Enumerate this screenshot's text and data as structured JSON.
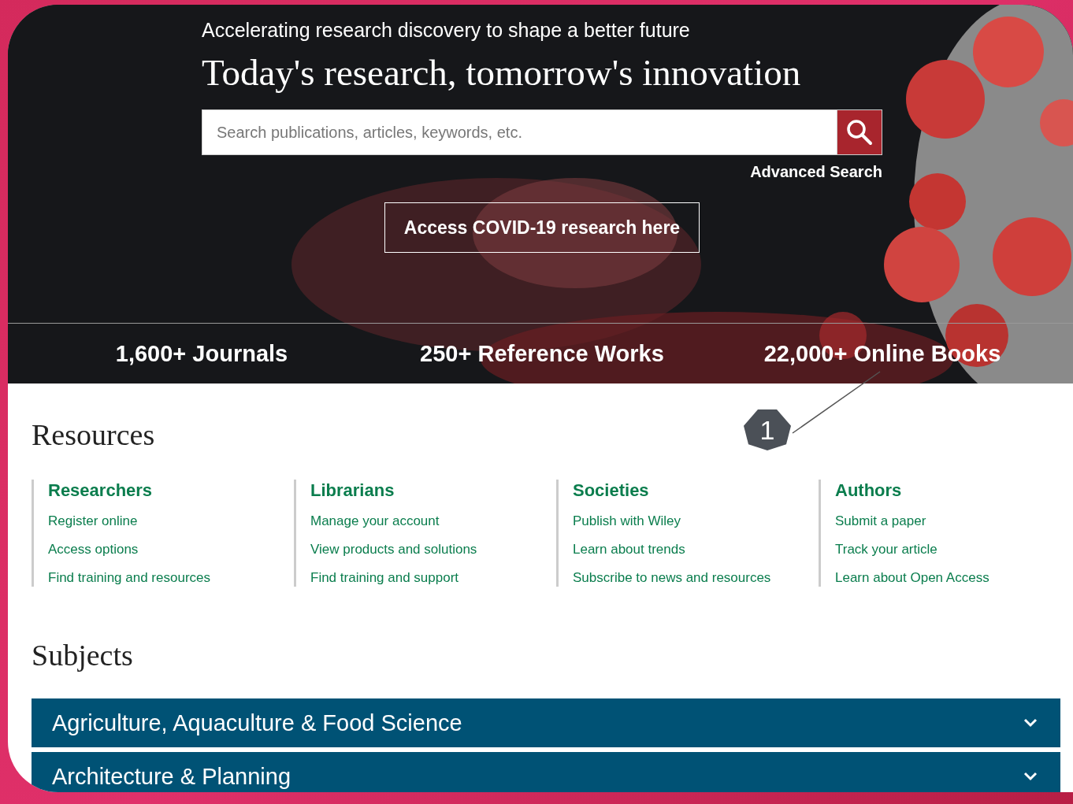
{
  "hero": {
    "tagline": "Accelerating research discovery to shape a better future",
    "headline": "Today's research, tomorrow's innovation",
    "search": {
      "placeholder": "Search publications, articles, keywords, etc."
    },
    "advanced_search": "Advanced Search",
    "cta": "Access COVID-19 research here"
  },
  "stats": [
    "1,600+ Journals",
    "250+ Reference Works",
    "22,000+ Online Books"
  ],
  "callout": {
    "label": "1"
  },
  "resources": {
    "title": "Resources",
    "columns": [
      {
        "heading": "Researchers",
        "links": [
          "Register online",
          "Access options",
          "Find training and resources"
        ]
      },
      {
        "heading": "Librarians",
        "links": [
          "Manage your account",
          "View products and solutions",
          "Find training and support"
        ]
      },
      {
        "heading": "Societies",
        "links": [
          "Publish with Wiley",
          "Learn about trends",
          "Subscribe to news and resources"
        ]
      },
      {
        "heading": "Authors",
        "links": [
          "Submit a paper",
          "Track your article",
          "Learn about Open Access"
        ]
      }
    ]
  },
  "subjects": {
    "title": "Subjects",
    "items": [
      {
        "label": "Agriculture, Aquaculture & Food Science",
        "expanded": false
      },
      {
        "label": "Architecture & Planning",
        "expanded": false
      }
    ]
  }
}
